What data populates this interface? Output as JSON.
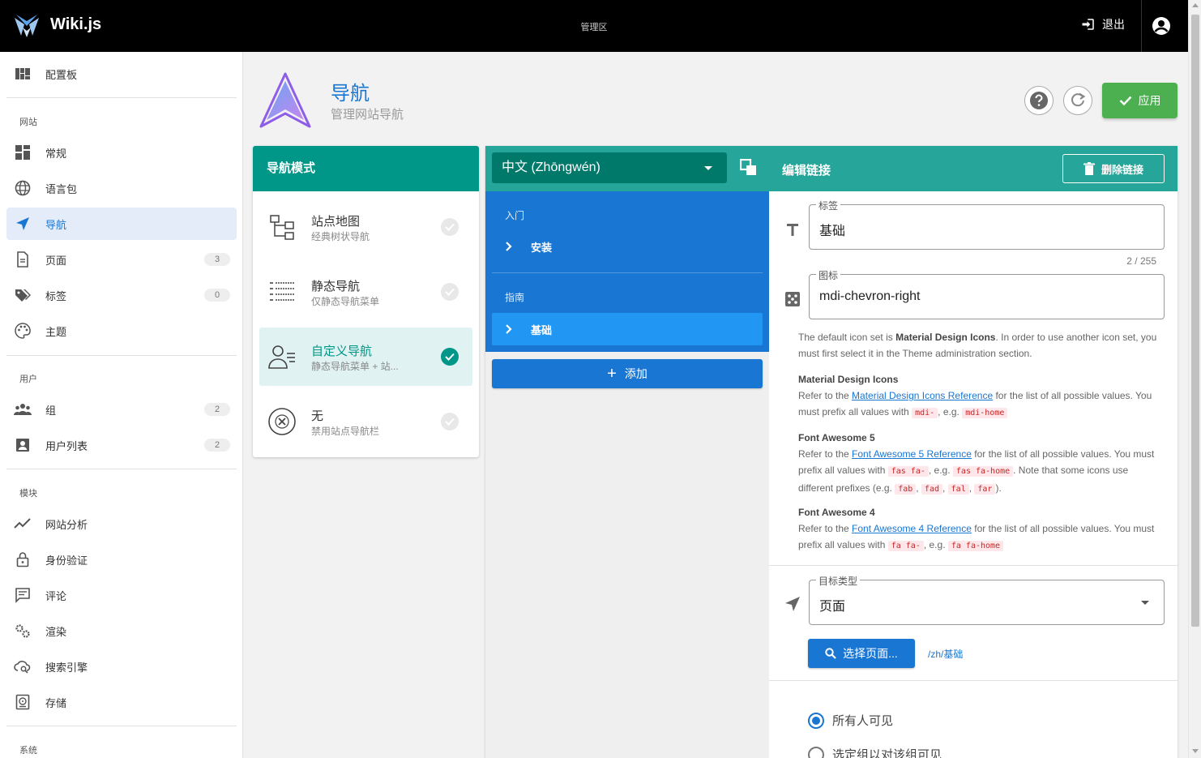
{
  "topbar": {
    "brand": "Wiki.js",
    "center_title": "管理区",
    "logout_label": "退出"
  },
  "sidebar": {
    "dashboard": "配置板",
    "sections": {
      "site": "网站",
      "users": "用户",
      "modules": "模块",
      "system": "系统"
    },
    "site_items": [
      {
        "label": "常规",
        "icon": "tune-icon"
      },
      {
        "label": "语言包",
        "icon": "globe-icon"
      },
      {
        "label": "导航",
        "icon": "navigation-icon",
        "active": true
      },
      {
        "label": "页面",
        "icon": "page-icon",
        "count": "3"
      },
      {
        "label": "标签",
        "icon": "tag-icon",
        "count": "0"
      },
      {
        "label": "主题",
        "icon": "palette-icon"
      }
    ],
    "user_items": [
      {
        "label": "组",
        "icon": "group-icon",
        "count": "2"
      },
      {
        "label": "用户列表",
        "icon": "user-list-icon",
        "count": "2"
      }
    ],
    "module_items": [
      {
        "label": "网站分析",
        "icon": "analytics-icon"
      },
      {
        "label": "身份验证",
        "icon": "lock-icon"
      },
      {
        "label": "评论",
        "icon": "comment-icon"
      },
      {
        "label": "渲染",
        "icon": "render-icon"
      },
      {
        "label": "搜索引擎",
        "icon": "search-engine-icon"
      },
      {
        "label": "存储",
        "icon": "storage-icon"
      }
    ]
  },
  "header": {
    "title": "导航",
    "subtitle": "管理网站导航",
    "apply_label": "应用"
  },
  "mode": {
    "title": "导航模式",
    "items": [
      {
        "name": "站点地图",
        "desc": "经典树状导航",
        "selected": false
      },
      {
        "name": "静态导航",
        "desc": "仅静态导航菜单",
        "selected": false
      },
      {
        "name": "自定义导航",
        "desc": "静态导航菜单 + 站...",
        "selected": true
      },
      {
        "name": "无",
        "desc": "禁用站点导航栏",
        "selected": false
      }
    ]
  },
  "editor": {
    "language": "中文 (Zhōngwén)",
    "edit_title": "编辑链接",
    "delete_label": "删除链接",
    "groups": [
      {
        "header": "入门",
        "links": [
          "安装"
        ]
      },
      {
        "header": "指南",
        "links": [
          "基础"
        ]
      }
    ],
    "add_label": "添加",
    "label_field": {
      "label": "标签",
      "value": "基础",
      "counter": "2 / 255"
    },
    "icon_field": {
      "label": "图标",
      "value": "mdi-chevron-right"
    },
    "help": {
      "intro_a": "The default icon set is ",
      "intro_b": "Material Design Icons",
      "intro_c": ". In order to use another icon set, you must first select it in the Theme administration section.",
      "mdi": {
        "title": "Material Design Icons",
        "refer": "Refer to the ",
        "link": "Material Design Icons Reference",
        "rest": " for the list of all possible values. You must prefix all values with ",
        "code1": "mdi-",
        "eg": ", e.g. ",
        "code2": "mdi-home"
      },
      "fa5": {
        "title": "Font Awesome 5",
        "refer": "Refer to the ",
        "link": "Font Awesome 5 Reference",
        "rest": " for the list of all possible values. You must prefix all values with ",
        "code1": "fas fa-",
        "eg": ", e.g. ",
        "code2": "fas fa-home",
        "note": ". Note that some icons use different prefixes (e.g. ",
        "p1": "fab",
        "p2": "fad",
        "p3": "fal",
        "p4": "far",
        "end": ")."
      },
      "fa4": {
        "title": "Font Awesome 4",
        "refer": "Refer to the ",
        "link": "Font Awesome 4 Reference",
        "rest": " for the list of all possible values. You must prefix all values with ",
        "code1": "fa fa-",
        "eg": ", e.g. ",
        "code2": "fa fa-home"
      }
    },
    "target_field": {
      "label": "目标类型",
      "value": "页面"
    },
    "pick_label": "选择页面...",
    "path": "/zh/基础",
    "visibility": [
      {
        "label": "所有人可见",
        "selected": true
      },
      {
        "label": "选定组以对该组可见",
        "selected": false
      }
    ]
  },
  "colors": {
    "primary": "#1976d2",
    "teal": "#009688",
    "apply": "#4caf50"
  }
}
